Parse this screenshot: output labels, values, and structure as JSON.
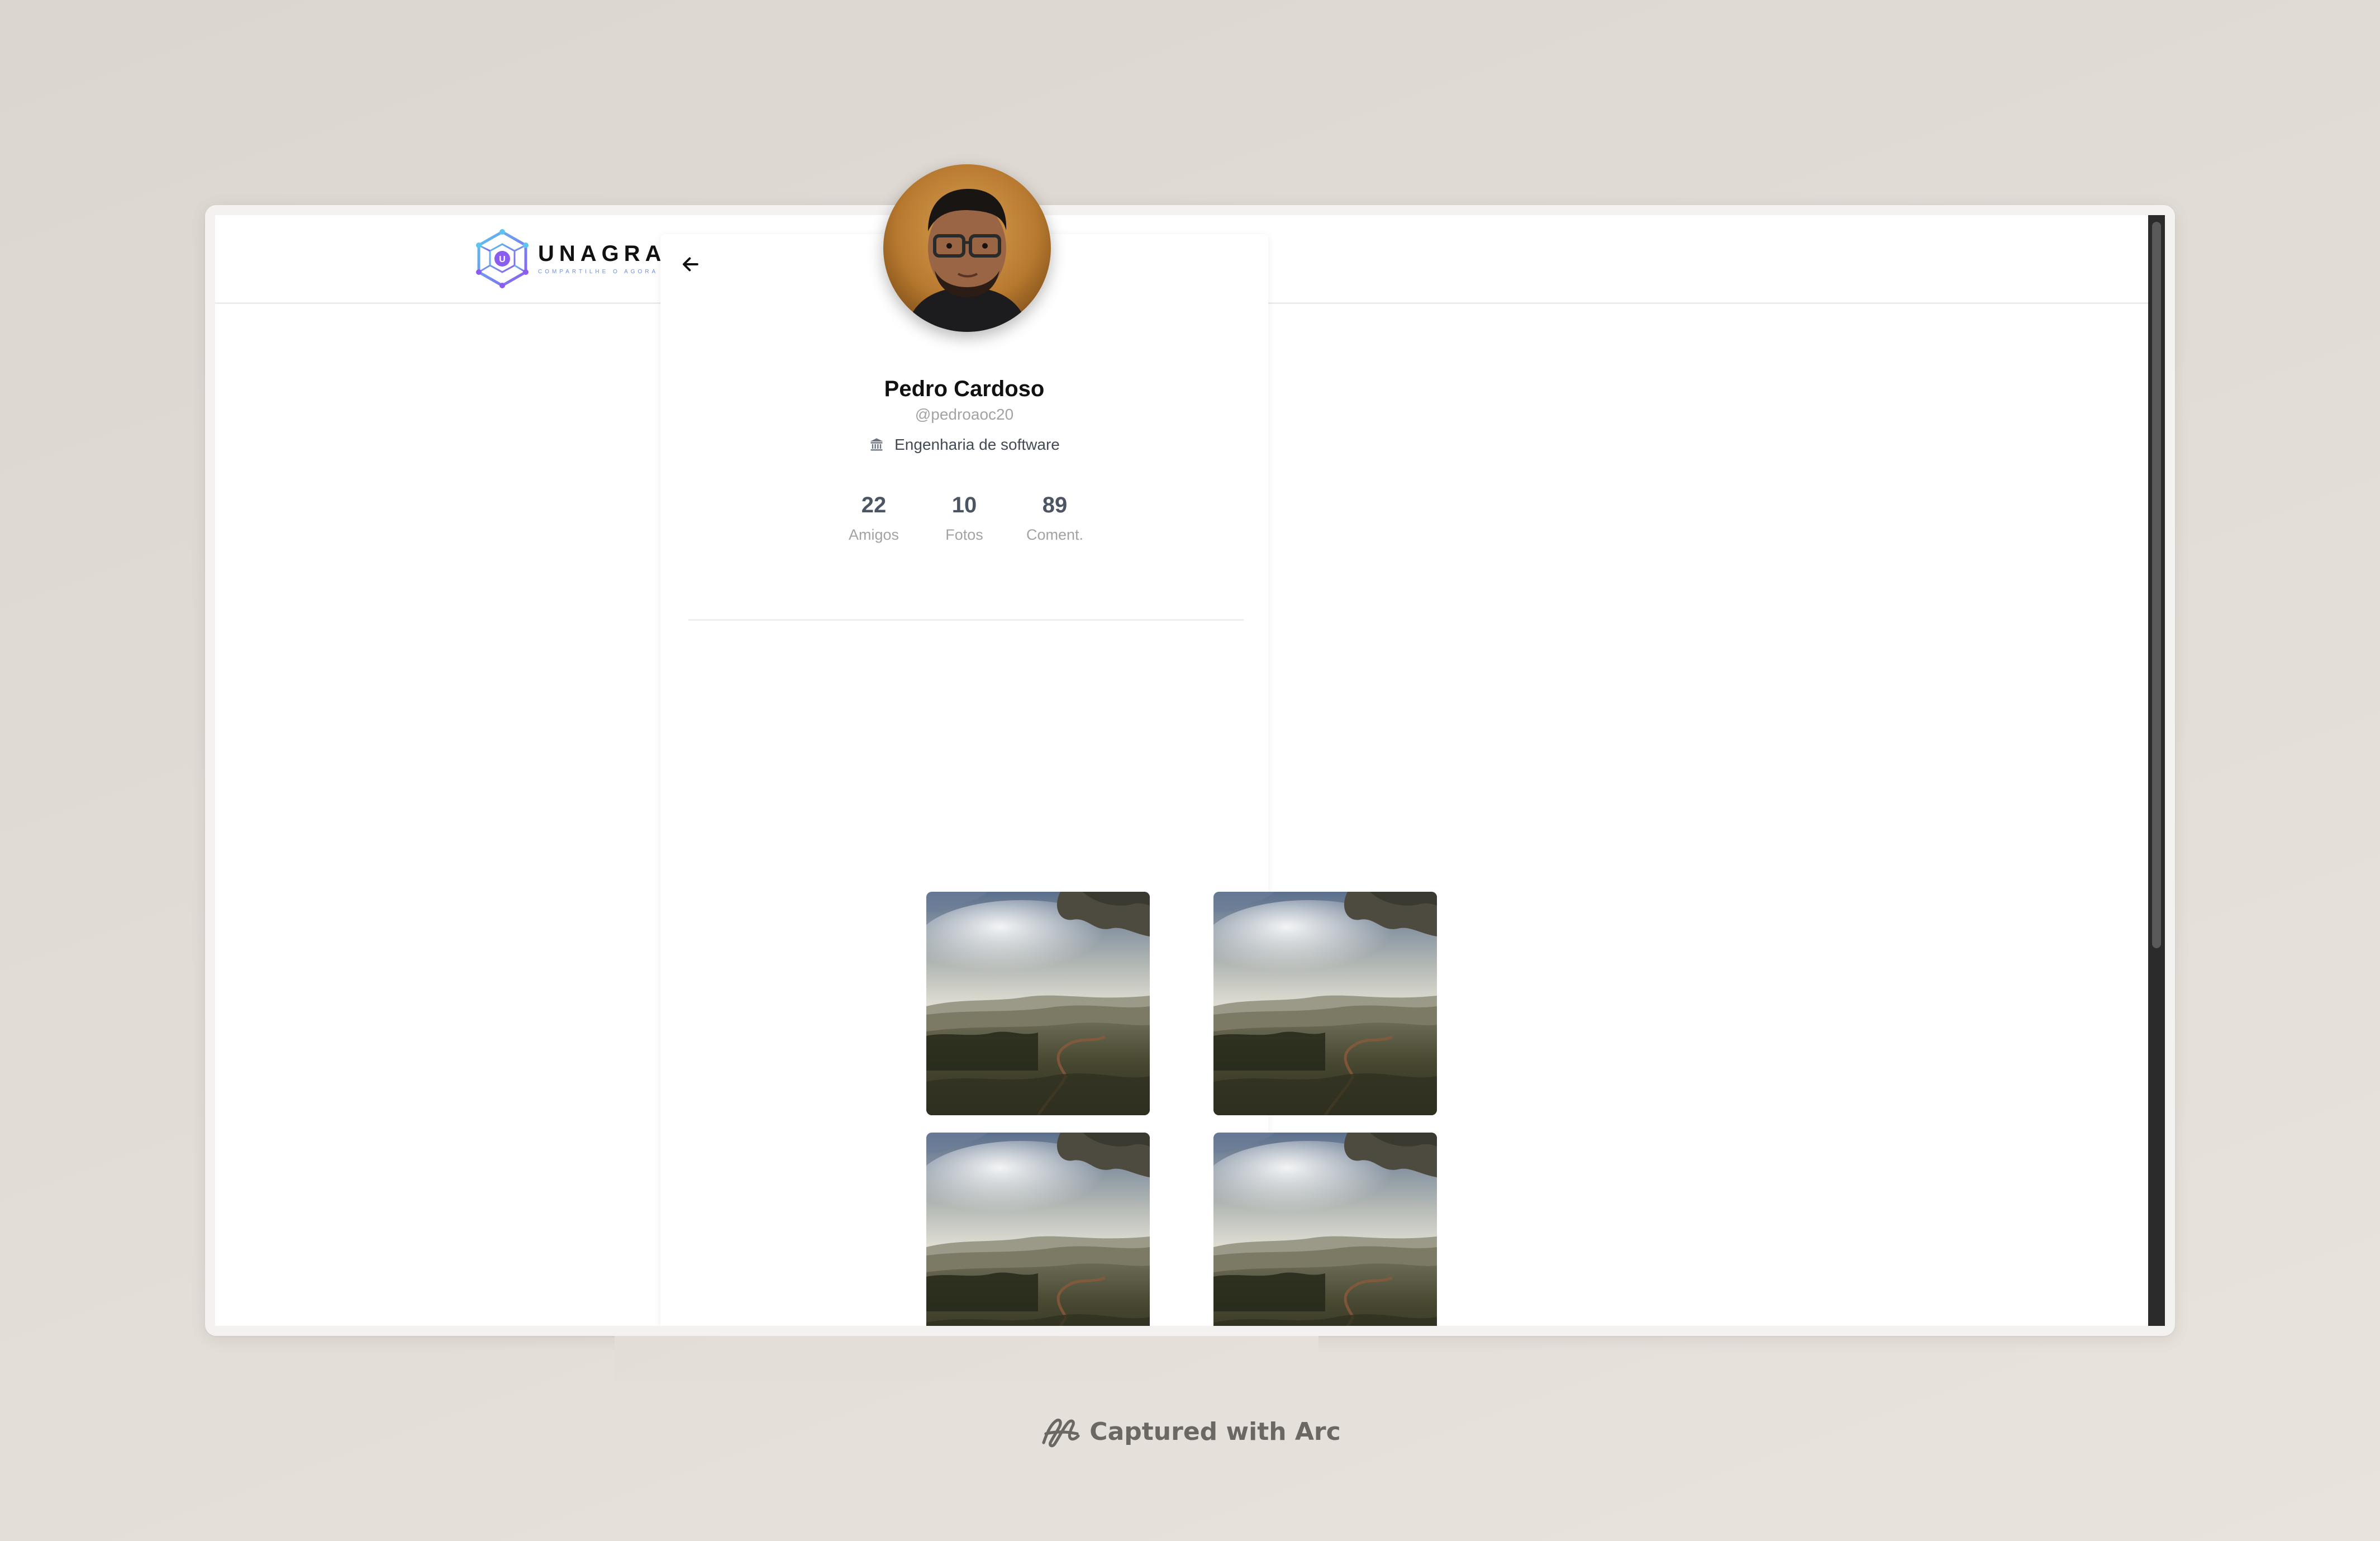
{
  "app": {
    "name": "UNAGRAM",
    "tagline": "Compartilhe o agora"
  },
  "profile": {
    "name": "Pedro Cardoso",
    "handle": "@pedroaoc20",
    "course": "Engenharia de software",
    "course_icon": "institution-icon",
    "back_icon": "arrow-left-icon"
  },
  "stats": [
    {
      "value": "22",
      "label": "Amigos"
    },
    {
      "value": "10",
      "label": "Fotos"
    },
    {
      "value": "89",
      "label": "Coment."
    }
  ],
  "photos": [
    {
      "subject": "landscape"
    },
    {
      "subject": "landscape"
    },
    {
      "subject": "landscape"
    },
    {
      "subject": "landscape"
    }
  ],
  "footer": {
    "caption": "Captured with Arc"
  },
  "colors": {
    "background": "#e2dcd6",
    "logo_accent": "#6f8fd8",
    "logo_purple": "#8a5cf0",
    "text_primary": "#111111",
    "text_muted": "#a3a3a3",
    "stat_value": "#4b5563"
  }
}
